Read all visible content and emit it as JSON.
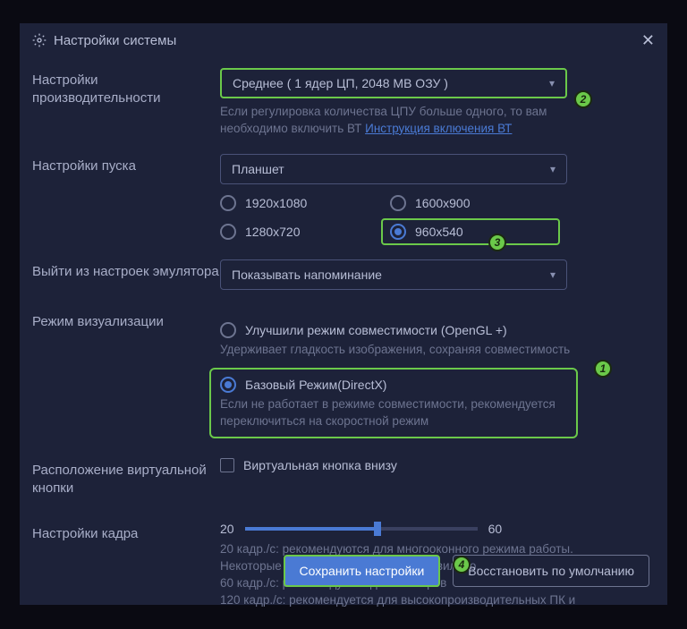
{
  "title": "Настройки системы",
  "performance": {
    "label": "Настройки производительности",
    "value": "Среднее ( 1 ядер ЦП, 2048 МВ ОЗУ )",
    "hint_prefix": "Если регулировка количества ЦПУ больше одного, то вам необходимо включить ВТ ",
    "hint_link": "Инструкция включения ВТ"
  },
  "launch": {
    "label": "Настройки пуска",
    "value": "Планшет",
    "resolutions": [
      "1920x1080",
      "1600x900",
      "1280x720",
      "960x540"
    ],
    "selected": "960x540"
  },
  "exit": {
    "label": "Выйти из настроек эмулятора",
    "value": "Показывать напоминание"
  },
  "render": {
    "label": "Режим визуализации",
    "opt1": "Улучшили режим совместимости (OpenGL +)",
    "opt1_desc": "Удерживает гладкость изображения, сохраняя совместимость",
    "opt2": "Базовый Режим(DirectX)",
    "opt2_desc": "Если не работает в режиме совместимости, рекомендуется переключиться на скоростной режим"
  },
  "vbutton": {
    "label": "Расположение виртуальной кнопки",
    "cb": "Виртуальная кнопка внизу"
  },
  "frame": {
    "label": "Настройки кадра",
    "min": "20",
    "max": "60",
    "hint": "20 кадр./с: рекомендуются для многооконного режима работы. Некоторые игры могут работать неправильно.\n60 кадр./с: рекомендуется для геймеров\n120 кадр./с: рекомендуется для высокопроизводительных ПК и"
  },
  "footer": {
    "save": "Сохранить настройки",
    "restore": "Восстановить по умолчанию"
  },
  "badges": {
    "b1": "1",
    "b2": "2",
    "b3": "3",
    "b4": "4"
  }
}
